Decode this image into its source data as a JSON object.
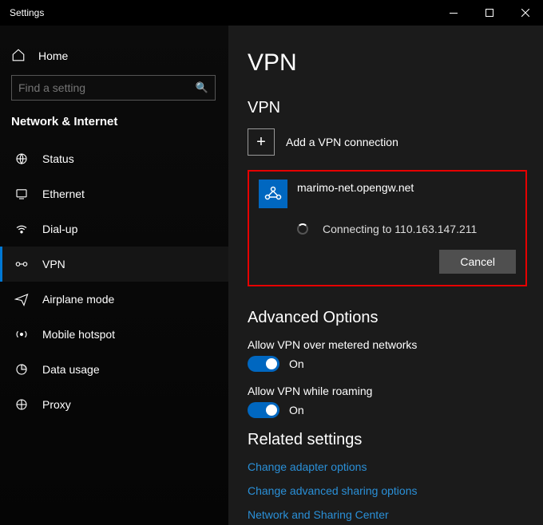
{
  "window": {
    "title": "Settings"
  },
  "sidebar": {
    "home_label": "Home",
    "search_placeholder": "Find a setting",
    "category": "Network & Internet",
    "items": [
      {
        "label": "Status"
      },
      {
        "label": "Ethernet"
      },
      {
        "label": "Dial-up"
      },
      {
        "label": "VPN"
      },
      {
        "label": "Airplane mode"
      },
      {
        "label": "Mobile hotspot"
      },
      {
        "label": "Data usage"
      },
      {
        "label": "Proxy"
      }
    ]
  },
  "main": {
    "page_title": "VPN",
    "section_title": "VPN",
    "add_label": "Add a VPN connection",
    "connection": {
      "name": "marimo-net.opengw.net",
      "status": "Connecting to 110.163.147.211",
      "cancel_label": "Cancel"
    },
    "advanced_title": "Advanced Options",
    "options": [
      {
        "label": "Allow VPN over metered networks",
        "state": "On"
      },
      {
        "label": "Allow VPN while roaming",
        "state": "On"
      }
    ],
    "related_title": "Related settings",
    "links": [
      "Change adapter options",
      "Change advanced sharing options",
      "Network and Sharing Center"
    ]
  }
}
